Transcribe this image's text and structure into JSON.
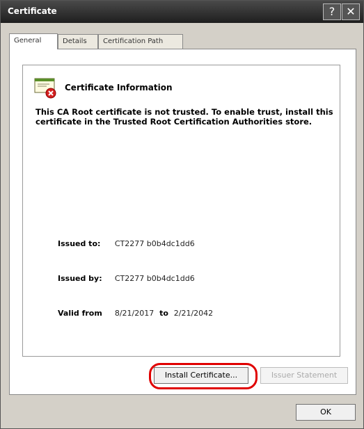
{
  "window": {
    "title": "Certificate",
    "help_glyph": "?",
    "close_glyph": "✕"
  },
  "tabs": [
    {
      "label": "General"
    },
    {
      "label": "Details"
    },
    {
      "label": "Certification Path"
    }
  ],
  "info": {
    "heading": "Certificate Information",
    "warning": "This CA Root certificate is not trusted. To enable trust, install this certificate in the Trusted Root Certification Authorities store.",
    "issued_to_label": "Issued to:",
    "issued_to_value": "CT2277 b0b4dc1dd6",
    "issued_by_label": "Issued by:",
    "issued_by_value": "CT2277 b0b4dc1dd6",
    "valid_label": "Valid from",
    "valid_from": "8/21/2017",
    "valid_to_word": "to",
    "valid_to": "2/21/2042"
  },
  "buttons": {
    "install": "Install Certificate...",
    "issuer": "Issuer Statement",
    "ok": "OK"
  },
  "colors": {
    "highlight": "#e00000"
  }
}
